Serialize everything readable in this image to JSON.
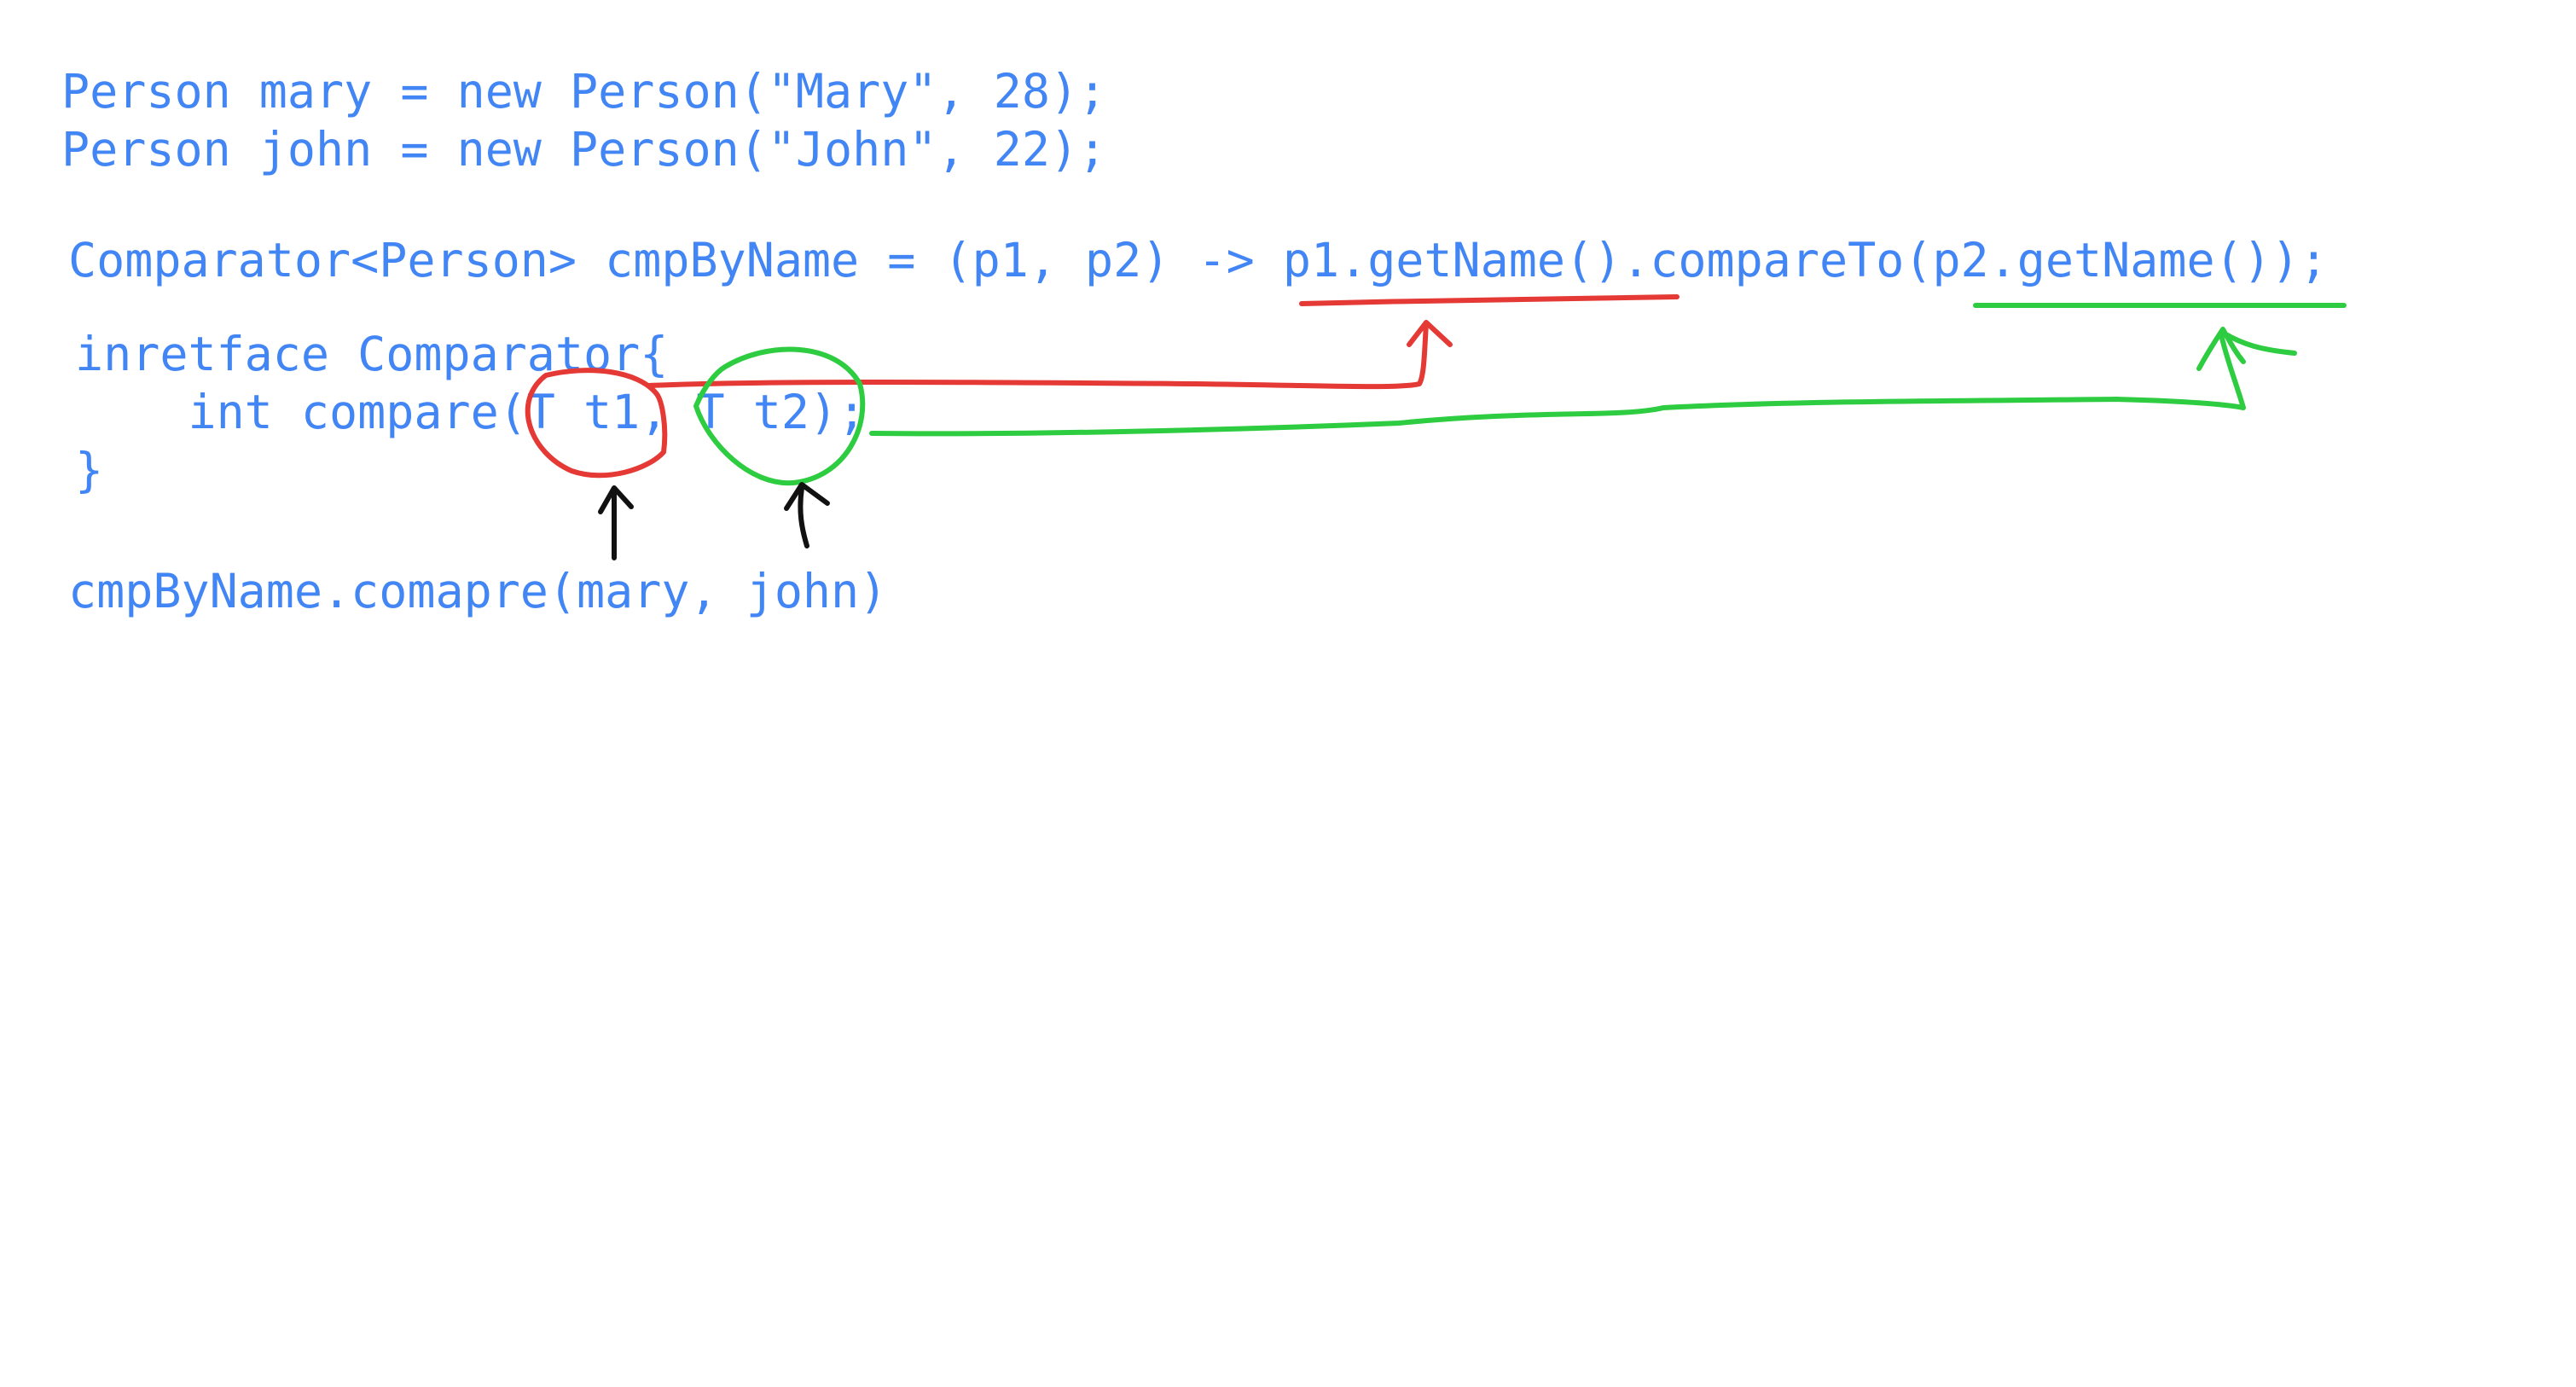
{
  "code": {
    "line_mary": "Person mary = new Person(\"Mary\", 28);",
    "line_john": "Person john = new Person(\"John\", 22);",
    "line_comparator": "Comparator<Person> cmpByName = (p1, p2) -> p1.getName().compareTo(p2.getName());",
    "line_interface": "inretface Comparator{",
    "line_compare": "    int compare(T t1, T t2);",
    "line_close": "}",
    "line_call": "cmpByName.comapre(mary, john)"
  },
  "colors": {
    "code_text": "#4285f4",
    "red_ink": "#e53935",
    "green_ink": "#2ecc40",
    "black_ink": "#111111",
    "background": "#ffffff"
  }
}
